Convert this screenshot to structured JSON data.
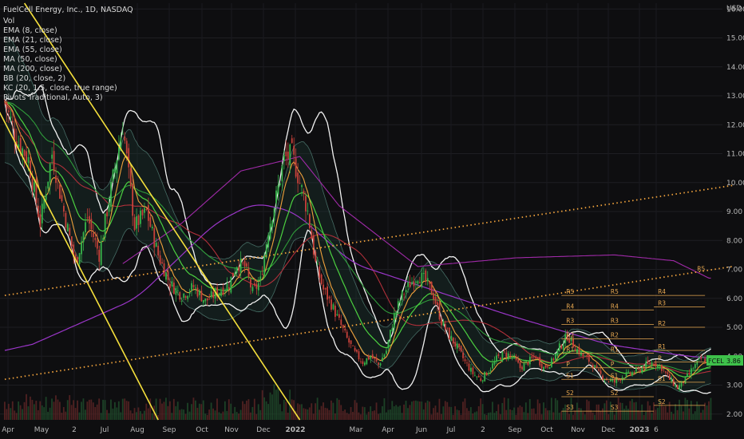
{
  "header": {
    "symbol_line": "FuelCell Energy, Inc., 1D, NASDAQ"
  },
  "indicator_legend": [
    "Vol",
    "EMA (8, close)",
    "EMA (21, close)",
    "EMA (55, close)",
    "MA (50, close)",
    "MA (200, close)",
    "BB (20, close, 2)",
    "KC (20, 1.5, close, true range)",
    "Pivots Traditional, Auto, 3)"
  ],
  "price_label": {
    "symbol": "FCEL",
    "value": "3.86",
    "color": "#3ec14a"
  },
  "colors": {
    "background": "#0e0e10",
    "candle_up": "#36b34a",
    "candle_down": "#c8413a",
    "ema8": "#f0a23c",
    "ema21": "#4cd140",
    "ema55": "#2f9b3a",
    "ma50": "#b0303a",
    "ma200": "#9a36c8",
    "bb": "#f2f2f2",
    "kc": "#6aa69a",
    "trend_yellow": "#f5e03c",
    "trend_orange": "#f0a23c",
    "pivot": "#e8a850"
  },
  "chart_data": {
    "type": "candlestick",
    "title": "FuelCell Energy, Inc., 1D, NASDAQ",
    "y_axis_label": "USD",
    "ylim": [
      1.8,
      16.2
    ],
    "yticks": [
      2.0,
      3.0,
      4.0,
      5.0,
      6.0,
      7.0,
      8.0,
      9.0,
      10.0,
      11.0,
      12.0,
      13.0,
      14.0,
      15.0,
      16.0
    ],
    "ytick_labels": [
      "2.00",
      "3.00",
      "4.00",
      "5.00",
      "6.00",
      "7.00",
      "8.00",
      "9.00",
      "10.00",
      "11.00",
      "12.00",
      "13.00",
      "14.00",
      "15.00",
      "16.00"
    ],
    "x_labels": [
      "Apr",
      "May",
      "2",
      "Jul",
      "Aug",
      "Sep",
      "Oct",
      "Nov",
      "Dec",
      "2022",
      "Mar",
      "Apr",
      "Jun",
      "Jul",
      "2",
      "Sep",
      "Oct",
      "Nov",
      "Dec",
      "2023",
      "6"
    ],
    "close_path": [
      [
        0,
        12.8
      ],
      [
        6,
        11.5
      ],
      [
        12,
        10.8
      ],
      [
        18,
        8.6
      ],
      [
        24,
        11.0
      ],
      [
        30,
        9.0
      ],
      [
        36,
        7.2
      ],
      [
        42,
        8.8
      ],
      [
        48,
        7.5
      ],
      [
        54,
        9.8
      ],
      [
        60,
        12.0
      ],
      [
        66,
        8.5
      ],
      [
        72,
        9.0
      ],
      [
        78,
        7.5
      ],
      [
        84,
        6.5
      ],
      [
        90,
        6.1
      ],
      [
        96,
        6.4
      ],
      [
        102,
        5.9
      ],
      [
        108,
        6.2
      ],
      [
        114,
        6.5
      ],
      [
        118,
        7.2
      ],
      [
        122,
        7.1
      ],
      [
        126,
        6.2
      ],
      [
        130,
        6.6
      ],
      [
        134,
        8.4
      ],
      [
        138,
        9.5
      ],
      [
        142,
        10.8
      ],
      [
        146,
        11.0
      ],
      [
        150,
        10.0
      ],
      [
        154,
        9.0
      ],
      [
        158,
        7.2
      ],
      [
        162,
        6.3
      ],
      [
        166,
        5.8
      ],
      [
        170,
        5.2
      ],
      [
        174,
        4.6
      ],
      [
        178,
        4.1
      ],
      [
        182,
        3.8
      ],
      [
        186,
        4.0
      ],
      [
        190,
        3.7
      ],
      [
        194,
        4.2
      ],
      [
        198,
        5.4
      ],
      [
        202,
        6.1
      ],
      [
        206,
        6.5
      ],
      [
        210,
        6.8
      ],
      [
        214,
        6.6
      ],
      [
        218,
        6.1
      ],
      [
        222,
        5.2
      ],
      [
        226,
        4.7
      ],
      [
        230,
        4.3
      ],
      [
        234,
        3.8
      ],
      [
        238,
        3.4
      ],
      [
        242,
        3.2
      ],
      [
        246,
        3.5
      ],
      [
        250,
        3.9
      ],
      [
        254,
        4.1
      ],
      [
        258,
        4.0
      ],
      [
        262,
        3.6
      ],
      [
        266,
        3.8
      ],
      [
        270,
        4.0
      ],
      [
        274,
        3.6
      ],
      [
        278,
        3.8
      ],
      [
        282,
        4.3
      ],
      [
        286,
        4.7
      ],
      [
        290,
        4.3
      ],
      [
        294,
        4.0
      ],
      [
        298,
        3.8
      ],
      [
        302,
        3.4
      ],
      [
        306,
        3.2
      ],
      [
        310,
        3.1
      ],
      [
        314,
        3.3
      ],
      [
        318,
        3.4
      ],
      [
        322,
        3.5
      ],
      [
        326,
        3.7
      ],
      [
        330,
        3.8
      ],
      [
        334,
        3.6
      ],
      [
        338,
        3.2
      ],
      [
        342,
        2.9
      ],
      [
        346,
        3.2
      ],
      [
        350,
        3.6
      ],
      [
        354,
        3.9
      ],
      [
        358,
        3.86
      ]
    ],
    "candle_count": 360,
    "volume_max": 1.0,
    "series_overlays": [
      "EMA 8",
      "EMA 21",
      "EMA 55",
      "MA 50",
      "MA 200",
      "BB (20,2)",
      "KC (20,1.5)"
    ],
    "pivot_labels": {
      "right_column": [
        "R4",
        "R3",
        "R2",
        "R1",
        "P",
        "S1",
        "S2"
      ],
      "middle_column": [
        "R5",
        "R4",
        "R3",
        "R2",
        "R1",
        "P",
        "S1",
        "S2",
        "S3"
      ],
      "left_column": [
        "R5",
        "R4",
        "R3",
        "R2",
        "R1",
        "P",
        "S1",
        "S2",
        "S3"
      ]
    },
    "pivot_levels_right": [
      6.1,
      5.7,
      5.0,
      4.2,
      3.8,
      3.1,
      2.3
    ],
    "pivot_levels_middle": [
      6.1,
      5.6,
      5.1,
      4.6,
      4.1,
      3.6,
      3.2,
      2.6,
      2.1
    ],
    "pivot_label_top": "R5",
    "trendlines": [
      {
        "kind": "yellow-solid",
        "from": [
          10,
          16.2
        ],
        "to": [
          150,
          1.8
        ]
      },
      {
        "kind": "yellow-solid",
        "from": [
          -10,
          13.4
        ],
        "to": [
          78,
          1.8
        ]
      },
      {
        "kind": "orange-dotted",
        "from": [
          0,
          6.1
        ],
        "to": [
          370,
          9.9
        ]
      },
      {
        "kind": "orange-dotted",
        "from": [
          0,
          3.2
        ],
        "to": [
          370,
          7.1
        ]
      }
    ]
  }
}
